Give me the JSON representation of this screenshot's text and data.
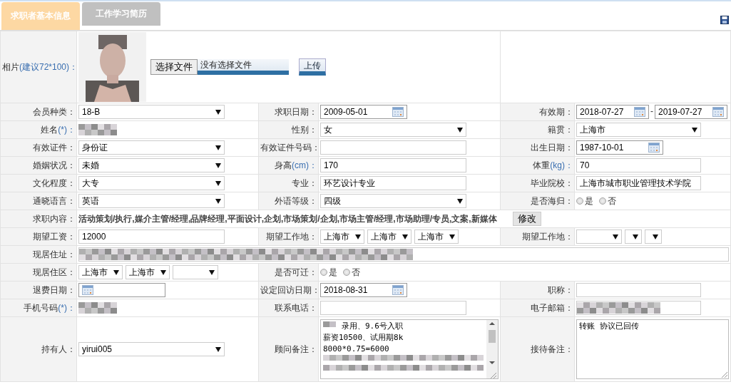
{
  "tabs": [
    {
      "label": "求职者基本信息",
      "selected": true
    },
    {
      "label": "工作学习简历",
      "selected": false
    }
  ],
  "rows": [
    [
      {
        "label": "相片",
        "note": "(建议72*100)：",
        "field": {
          "choose_button": "选择文件",
          "file_status": "没有选择文件",
          "upload_button": "上传"
        }
      }
    ],
    [
      {
        "label": "会员种类：",
        "field": {
          "kind": "select",
          "value": "18-B"
        }
      },
      {
        "label": "求职日期：",
        "field": {
          "kind": "date",
          "value": "2009-05-01"
        }
      },
      {
        "label": "有效期：",
        "field": {
          "kind": "daterange",
          "values": [
            "2018-07-27",
            "2019-07-27"
          ],
          "separator": "-"
        }
      }
    ],
    [
      {
        "label": "姓名",
        "note": "(*)：",
        "field": {
          "kind": "blurred"
        }
      },
      {
        "label": "性别：",
        "field": {
          "kind": "select",
          "value": "女"
        }
      },
      {
        "label": "籍贯：",
        "field": {
          "kind": "select",
          "value": "上海市"
        }
      }
    ],
    [
      {
        "label": "有效证件：",
        "field": {
          "kind": "select",
          "value": "身份证"
        }
      },
      {
        "label": "有效证件号码：",
        "field": {
          "kind": "input"
        }
      },
      {
        "label": "出生日期：",
        "field": {
          "kind": "date",
          "value": "1987-10-01"
        }
      }
    ],
    [
      {
        "label": "婚姻状况：",
        "field": {
          "kind": "select",
          "value": "未婚"
        }
      },
      {
        "label": "身高",
        "note": "(cm)：",
        "field": {
          "kind": "input",
          "value": "170"
        }
      },
      {
        "label": "体重",
        "note": "(kg)：",
        "field": {
          "kind": "input",
          "value": "70"
        }
      }
    ],
    [
      {
        "label": "文化程度：",
        "field": {
          "kind": "select",
          "value": "大专"
        }
      },
      {
        "label": "专业：",
        "field": {
          "kind": "input",
          "value": "环艺设计专业"
        }
      },
      {
        "label": "毕业院校：",
        "field": {
          "kind": "input",
          "value": "上海市城市职业管理技术学院"
        }
      }
    ],
    [
      {
        "label": "通晓语言：",
        "field": {
          "kind": "select",
          "value": "英语"
        }
      },
      {
        "label": "外语等级：",
        "field": {
          "kind": "select",
          "value": "四级"
        }
      },
      {
        "label": "是否海归：",
        "field": {
          "kind": "radio",
          "options": [
            {
              "label": "是",
              "selected": false
            },
            {
              "label": "否",
              "selected": false
            }
          ]
        }
      }
    ],
    [
      {
        "label": "求职内容：",
        "field": {
          "kind": "text_button",
          "text": "活动策划/执行,媒介主管/经理,品牌经理,平面设计,企划,市场策划/企划,市场主管/经理,市场助理/专员,文案,新媒体",
          "button": "修改"
        }
      }
    ],
    [
      {
        "label": "期望工资：",
        "field": {
          "kind": "input",
          "value": "12000"
        }
      },
      {
        "label": "期望工作地：",
        "field": {
          "kind": "selects",
          "items": [
            {
              "kind": "value",
              "value": "上海市"
            },
            {
              "kind": "value",
              "value": "上海市"
            },
            {
              "kind": "value",
              "value": "上海市"
            }
          ]
        }
      },
      {
        "label": "期望工作地：",
        "field": {
          "kind": "selects",
          "items": [
            {
              "kind": "empty_wide"
            },
            {
              "kind": "empty"
            },
            {
              "kind": "empty"
            }
          ]
        }
      }
    ],
    [
      {
        "label": "现居住址：",
        "field": {
          "kind": "blurred_wide"
        }
      }
    ],
    [
      {
        "label": "现居住区：",
        "field": {
          "kind": "selects",
          "items": [
            {
              "kind": "value",
              "value": "上海市"
            },
            {
              "kind": "value",
              "value": "上海市"
            },
            {
              "kind": "empty_wide"
            }
          ]
        }
      },
      {
        "label": "是否可迁：",
        "field": {
          "kind": "radio",
          "options": [
            {
              "label": "是",
              "selected": false
            },
            {
              "label": "否",
              "selected": false
            }
          ]
        }
      }
    ],
    [
      {
        "label": "退费日期：",
        "field": {
          "kind": "date"
        }
      },
      {
        "label": "设定回访日期：",
        "field": {
          "kind": "date",
          "value": "2018-08-31"
        }
      },
      {
        "label": "职称：",
        "field": {
          "kind": "input"
        }
      }
    ],
    [
      {
        "label": "手机号码",
        "note": "(*)：",
        "field": {
          "kind": "blurred"
        }
      },
      {
        "label": "联系电话：",
        "field": {
          "kind": "input"
        }
      },
      {
        "label": "电子邮箱：",
        "field": {
          "kind": "blurred_box"
        }
      }
    ],
    [
      {
        "label": "持有人：",
        "field": {
          "kind": "select",
          "value": "yirui005"
        }
      },
      {
        "label": "顾问备注：",
        "field": {
          "kind": "textarea",
          "scroll": true,
          "lines": [
            {
              "kind": "blurred_prefix",
              "text": "录用、9.6号入职"
            },
            {
              "kind": "text",
              "text": "薪资10500、试用期8k"
            },
            {
              "kind": "text",
              "text": "8000*0.75=6000"
            },
            {
              "kind": "blurred"
            },
            {
              "kind": "blurred"
            }
          ]
        }
      },
      {
        "label": "接待备注：",
        "field": {
          "kind": "textarea",
          "scroll": false,
          "lines": [
            {
              "kind": "text",
              "text": "转账 协议已回传"
            }
          ]
        }
      }
    ]
  ]
}
